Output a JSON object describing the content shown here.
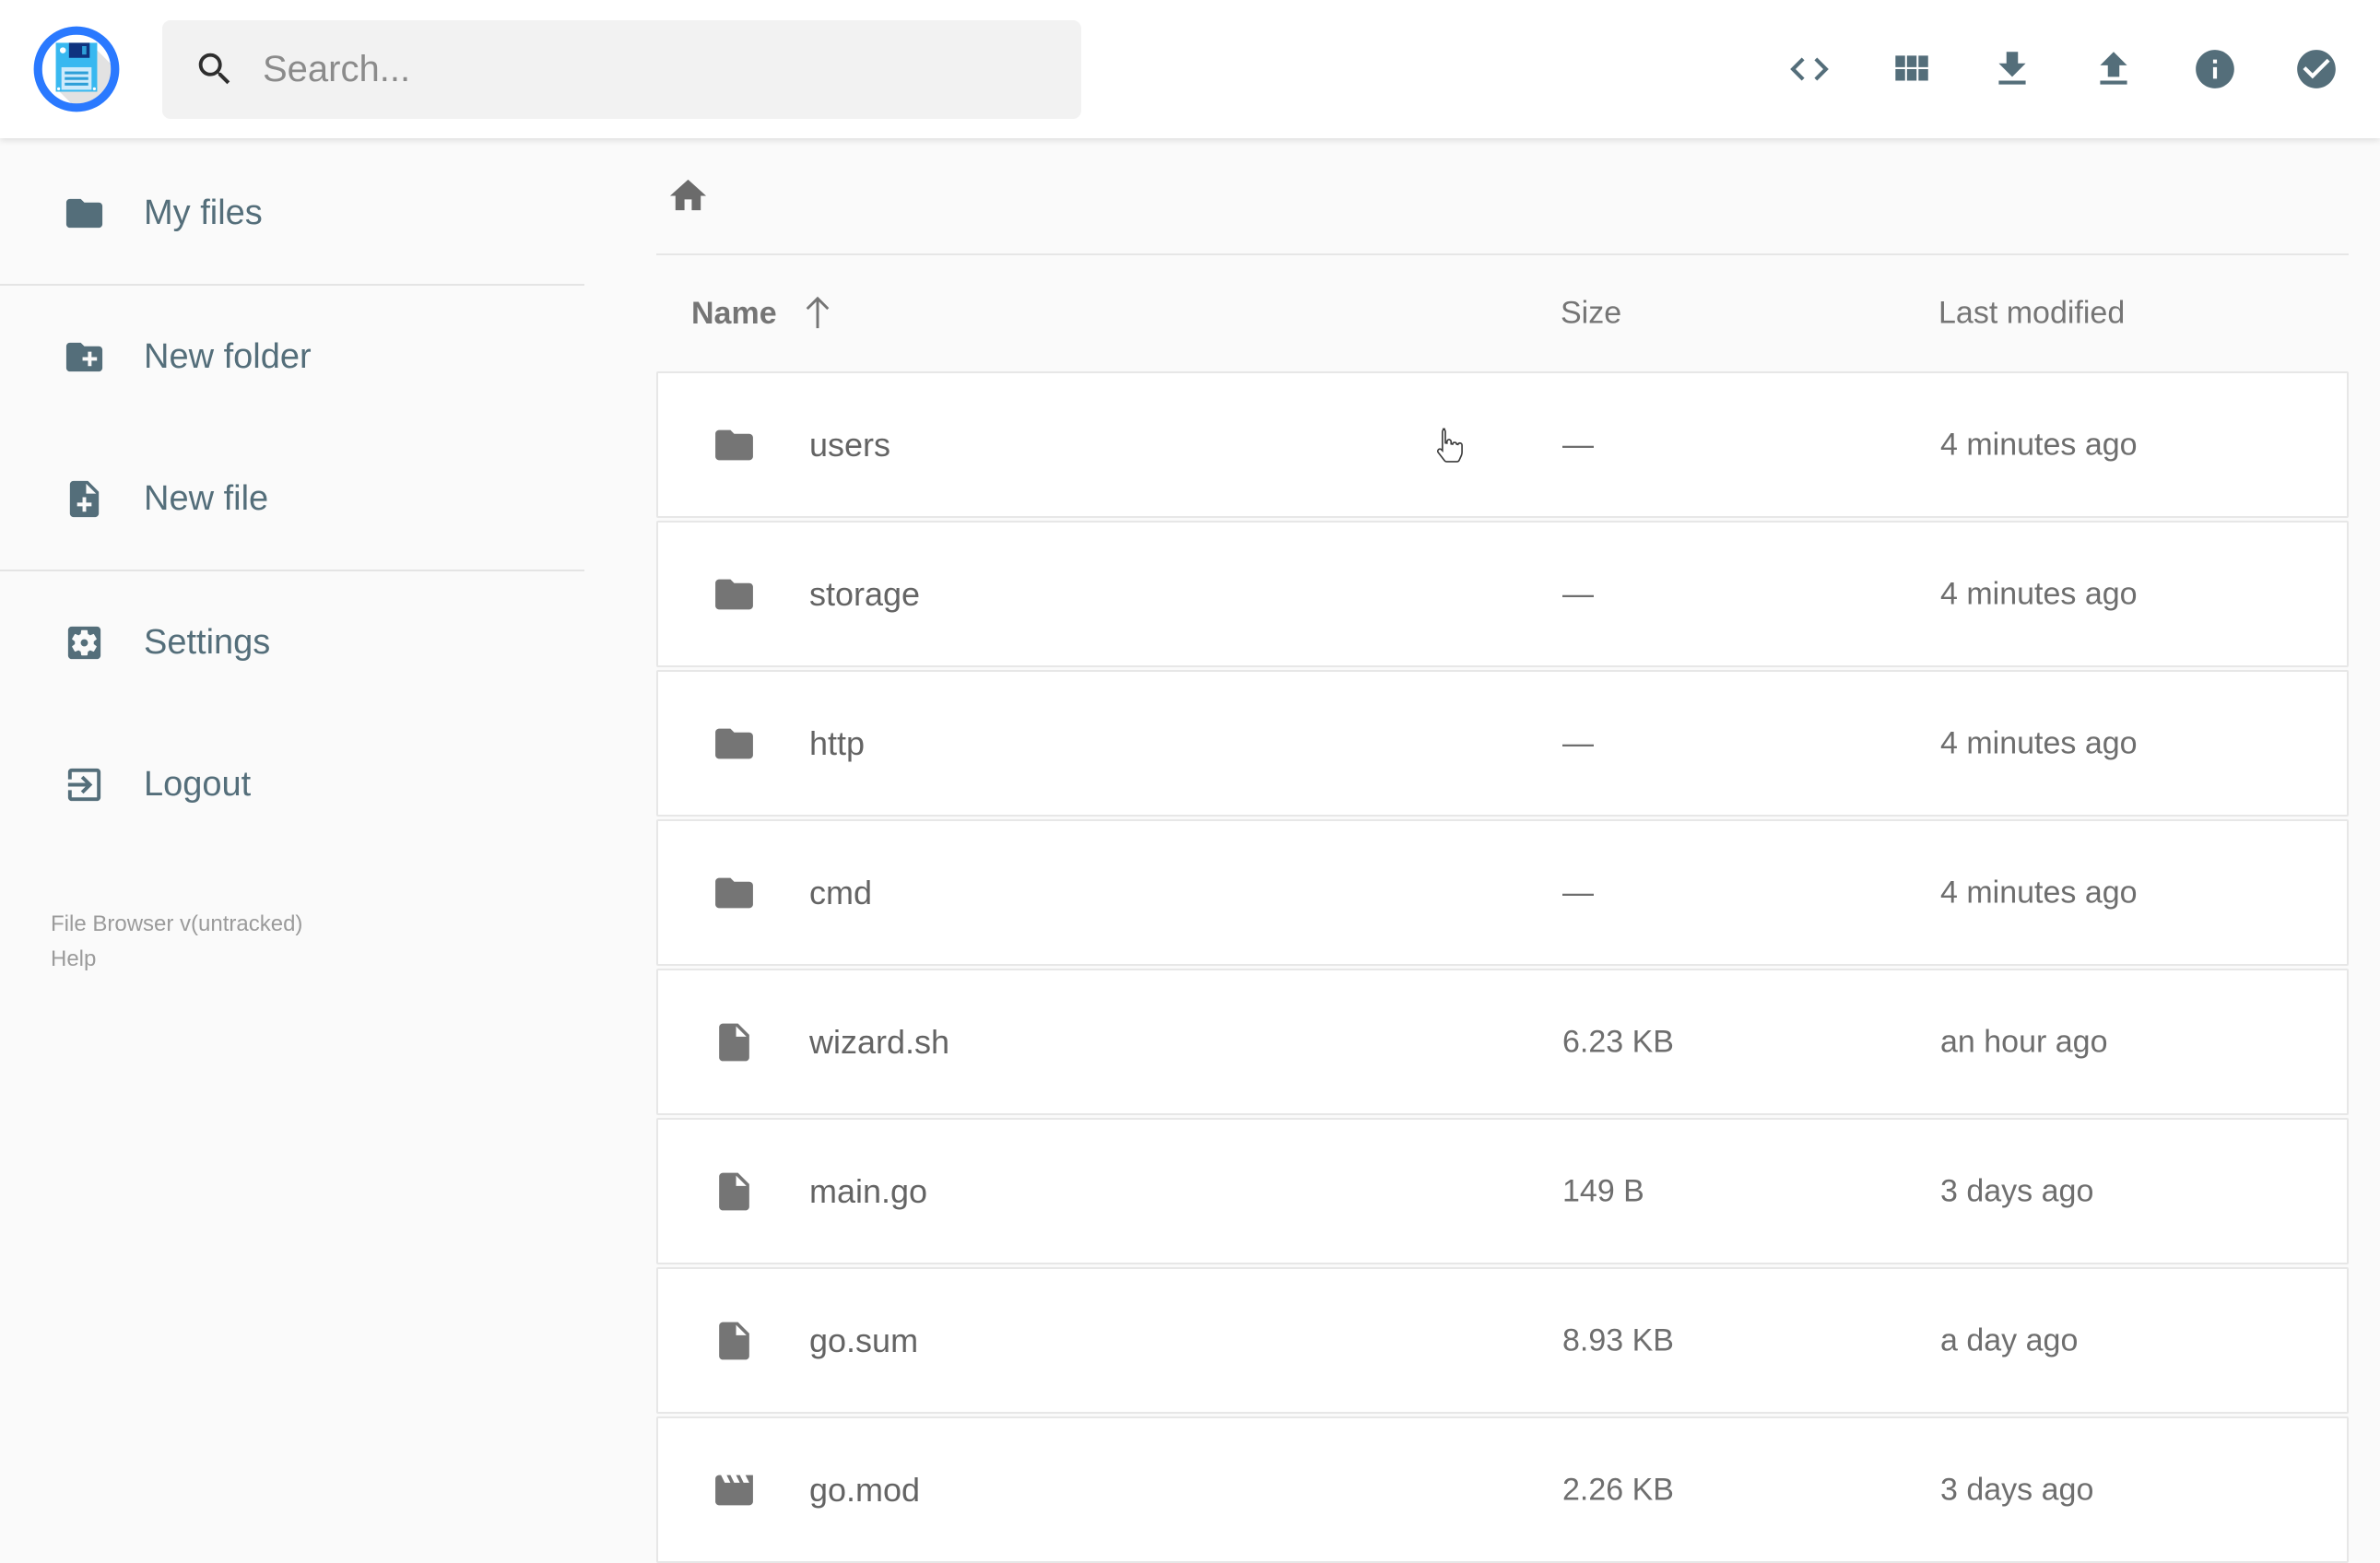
{
  "app": {
    "title": "File Browser"
  },
  "header": {
    "search_placeholder": "Search...",
    "action_icons": [
      "code-icon",
      "grid-view-icon",
      "download-icon",
      "upload-icon",
      "info-icon",
      "select-check-icon"
    ]
  },
  "sidebar": {
    "items": [
      {
        "label": "My files",
        "icon": "folder-icon"
      },
      {
        "label": "New folder",
        "icon": "new-folder-icon"
      },
      {
        "label": "New file",
        "icon": "new-file-icon"
      },
      {
        "label": "Settings",
        "icon": "settings-icon"
      },
      {
        "label": "Logout",
        "icon": "logout-icon"
      }
    ],
    "footer": {
      "version": "File Browser v(untracked)",
      "help": "Help"
    }
  },
  "breadcrumb": {
    "icon": "home-icon"
  },
  "listing": {
    "columns": {
      "name": "Name",
      "size": "Size",
      "modified": "Last modified"
    },
    "sort": {
      "column": "Name",
      "direction": "ascending",
      "icon": "sort-arrow-up-icon"
    },
    "rows": [
      {
        "name": "users",
        "type": "folder",
        "size": "—",
        "modified": "4 minutes ago"
      },
      {
        "name": "storage",
        "type": "folder",
        "size": "—",
        "modified": "4 minutes ago"
      },
      {
        "name": "http",
        "type": "folder",
        "size": "—",
        "modified": "4 minutes ago"
      },
      {
        "name": "cmd",
        "type": "folder",
        "size": "—",
        "modified": "4 minutes ago"
      },
      {
        "name": "wizard.sh",
        "type": "file",
        "size": "6.23 KB",
        "modified": "an hour ago"
      },
      {
        "name": "main.go",
        "type": "file",
        "size": "149 B",
        "modified": "3 days ago"
      },
      {
        "name": "go.sum",
        "type": "file",
        "size": "8.93 KB",
        "modified": "a day ago"
      },
      {
        "name": "go.mod",
        "type": "movie",
        "size": "2.26 KB",
        "modified": "3 days ago"
      }
    ]
  },
  "colors": {
    "accent_blue": "#2a79ff",
    "logo_floppy": "#38b8f0",
    "slate_icons": "#546e7a",
    "row_icon_gray": "#757575",
    "row_text_gray": "#646464",
    "background": "#fafafa",
    "row_border": "#e7e7e7"
  }
}
